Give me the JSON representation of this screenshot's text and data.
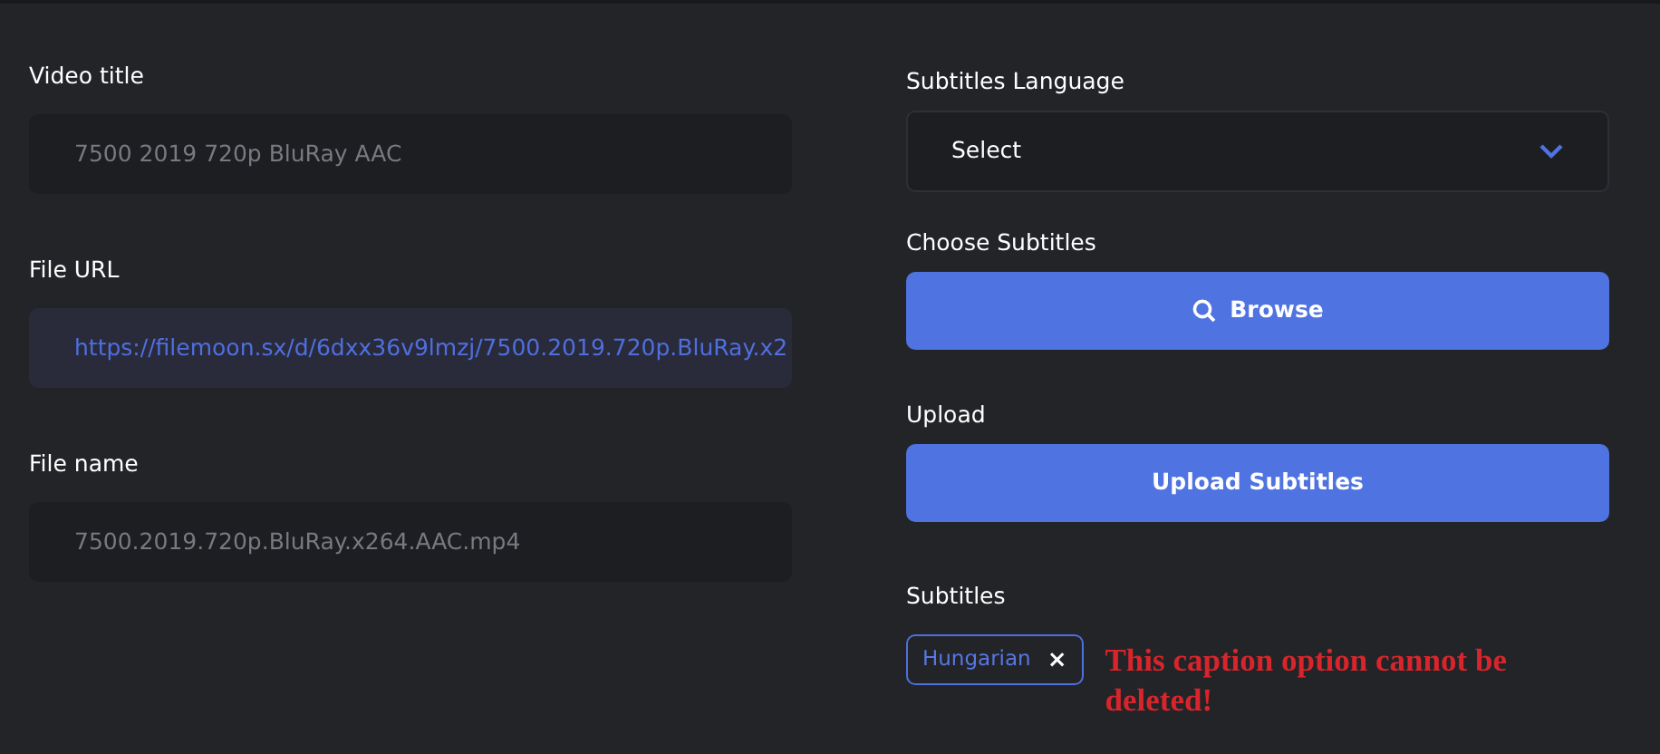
{
  "left_fields": [
    {
      "label": "Video title",
      "value": "7500 2019 720p BluRay AAC",
      "kind": "plain"
    },
    {
      "label": "File URL",
      "value": "https://filemoon.sx/d/6dxx36v9lmzj/7500.2019.720p.BluRay.x2",
      "kind": "link"
    },
    {
      "label": "File name",
      "value": "7500.2019.720p.BluRay.x264.AAC.mp4",
      "kind": "plain"
    }
  ],
  "subtitles_language": {
    "label": "Subtitles Language",
    "value": "Select"
  },
  "choose_subtitles": {
    "label": "Choose Subtitles",
    "button": "Browse"
  },
  "upload": {
    "label": "Upload",
    "button": "Upload Subtitles"
  },
  "subtitles": {
    "label": "Subtitles",
    "tags": [
      {
        "label": "Hungarian",
        "remove": "×"
      }
    ]
  },
  "note": "This caption option cannot be deleted!"
}
